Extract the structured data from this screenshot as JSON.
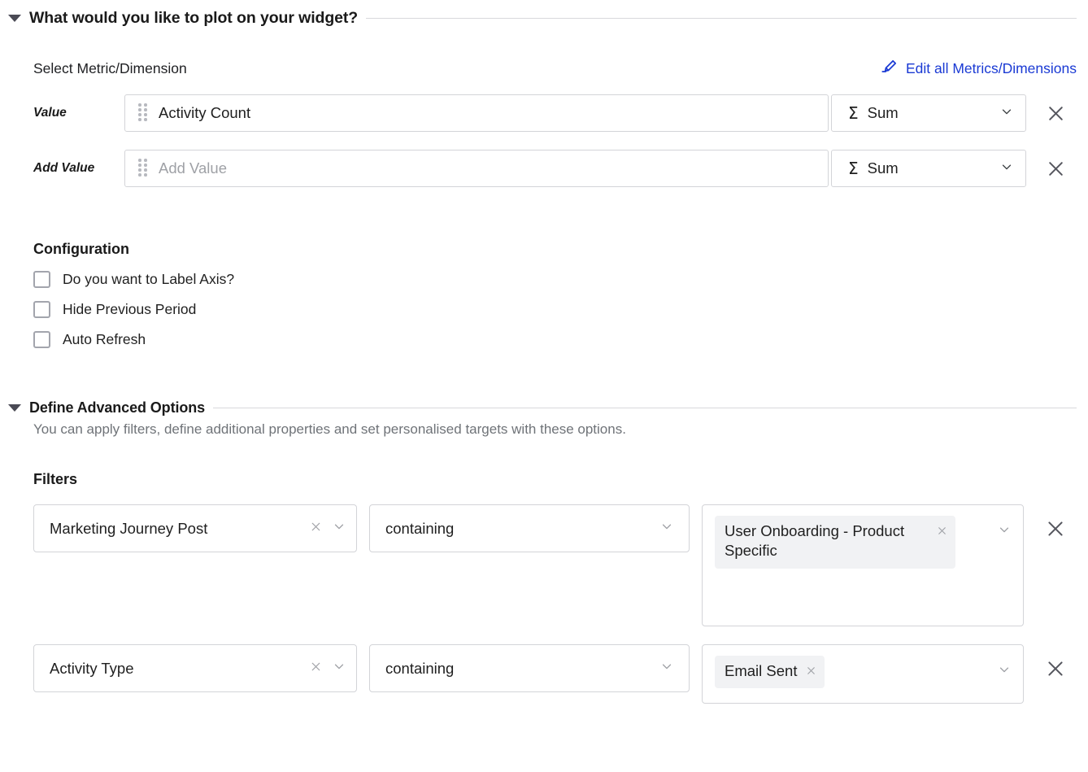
{
  "plot_section": {
    "title": "What would you like to plot on your widget?",
    "expanded_icon": "caret-down-icon",
    "subhead": "Select Metric/Dimension",
    "edit_link": "Edit all Metrics/Dimensions",
    "edit_icon": "pencil-edit-icon",
    "rows": [
      {
        "label": "Value",
        "value": "Activity Count",
        "placeholder": "",
        "is_placeholder": false,
        "aggregation": "Sum",
        "aggregation_icon": "sigma-icon"
      },
      {
        "label": "Add Value",
        "value": "",
        "placeholder": "Add Value",
        "is_placeholder": true,
        "aggregation": "Sum",
        "aggregation_icon": "sigma-icon"
      }
    ]
  },
  "configuration": {
    "title": "Configuration",
    "options": [
      {
        "label": "Do you want to Label Axis?",
        "checked": false
      },
      {
        "label": "Hide Previous Period",
        "checked": false
      },
      {
        "label": "Auto Refresh",
        "checked": false
      }
    ]
  },
  "advanced": {
    "title": "Define Advanced Options",
    "description": "You can apply filters, define additional properties and set personalised targets with these options.",
    "filters_title": "Filters",
    "filters": [
      {
        "field": "Marketing Journey Post",
        "operator": "containing",
        "values": [
          "User Onboarding - Product Specific"
        ]
      },
      {
        "field": "Activity Type",
        "operator": "containing",
        "values": [
          "Email Sent"
        ]
      }
    ]
  },
  "colors": {
    "link": "#1a3ad4",
    "border": "#d3d4d8",
    "chip_bg": "#f1f2f4",
    "muted_text": "#6f7378",
    "placeholder_text": "#9fa1a6"
  }
}
